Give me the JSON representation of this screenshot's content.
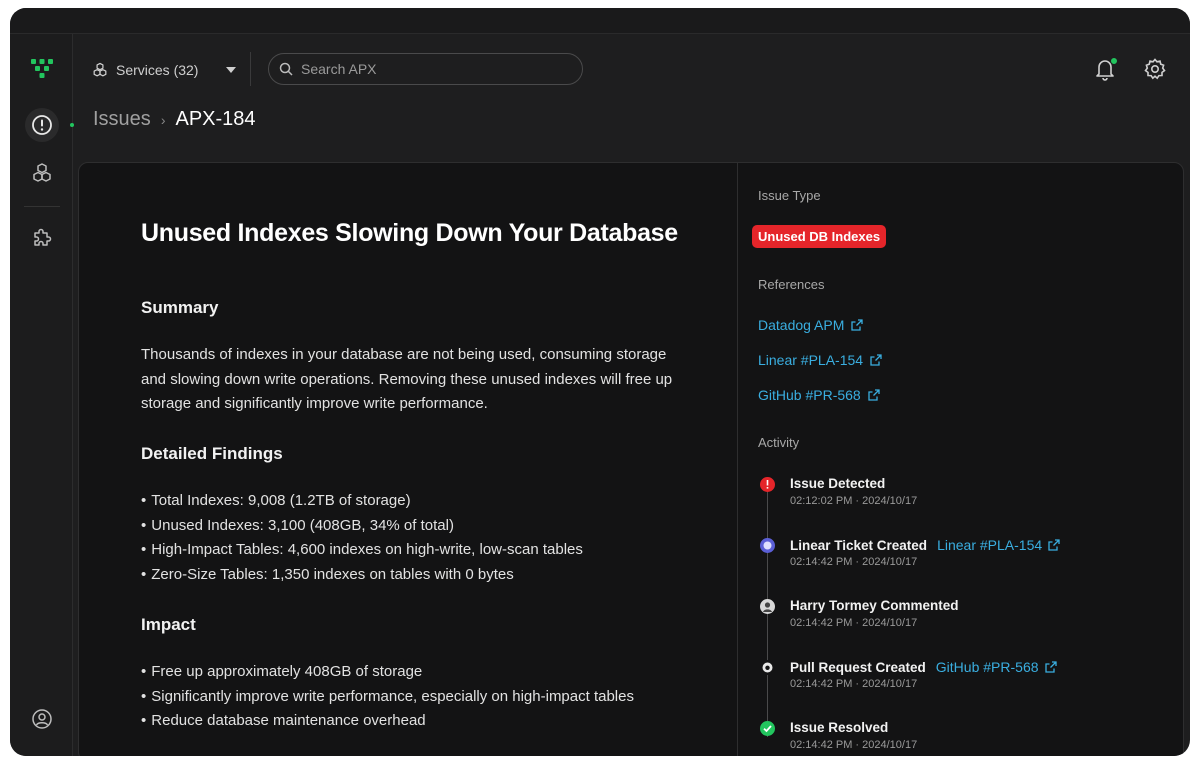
{
  "topbar": {
    "services_label": "Services (32)",
    "search_placeholder": "Search APX"
  },
  "breadcrumb": {
    "parent": "Issues",
    "separator": "›",
    "current": "APX-184"
  },
  "issue": {
    "title": "Unused Indexes Slowing Down Your Database",
    "summary_heading": "Summary",
    "summary_text": "Thousands of indexes in your database are not being used, consuming storage and slowing down write operations. Removing these unused indexes will free up storage and significantly improve write performance.",
    "findings_heading": "Detailed Findings",
    "findings": [
      "Total Indexes: 9,008 (1.2TB of storage)",
      "Unused Indexes: 3,100 (408GB, 34% of total)",
      "High-Impact Tables: 4,600 indexes on high-write, low-scan tables",
      "Zero-Size Tables: 1,350 indexes on tables with 0 bytes"
    ],
    "impact_heading": "Impact",
    "impact": [
      "Free up approximately 408GB of storage",
      "Significantly improve write performance, especially on high-impact tables",
      "Reduce database maintenance overhead"
    ]
  },
  "panel": {
    "issue_type_label": "Issue Type",
    "issue_type_badge": "Unused DB Indexes",
    "references_label": "References",
    "references": [
      "Datadog APM",
      "Linear #PLA-154",
      "GitHub #PR-568"
    ],
    "activity_label": "Activity",
    "activity": [
      {
        "title": "Issue Detected",
        "link": "",
        "time": "02:12:02 PM · 2024/10/17",
        "icon": "alert-icon"
      },
      {
        "title": "Linear Ticket Created",
        "link": "Linear #PLA-154",
        "time": "02:14:42 PM · 2024/10/17",
        "icon": "linear-icon"
      },
      {
        "title": "Harry Tormey Commented",
        "link": "",
        "time": "02:14:42 PM · 2024/10/17",
        "icon": "user-avatar-icon"
      },
      {
        "title": "Pull Request Created",
        "link": "GitHub #PR-568",
        "time": "02:14:42 PM · 2024/10/17",
        "icon": "github-icon"
      },
      {
        "title": "Issue Resolved",
        "link": "",
        "time": "02:14:42 PM · 2024/10/17",
        "icon": "check-icon"
      }
    ]
  },
  "colors": {
    "accent_green": "#22c55e",
    "badge_red": "#e5252a",
    "link_blue": "#3aaee0"
  }
}
